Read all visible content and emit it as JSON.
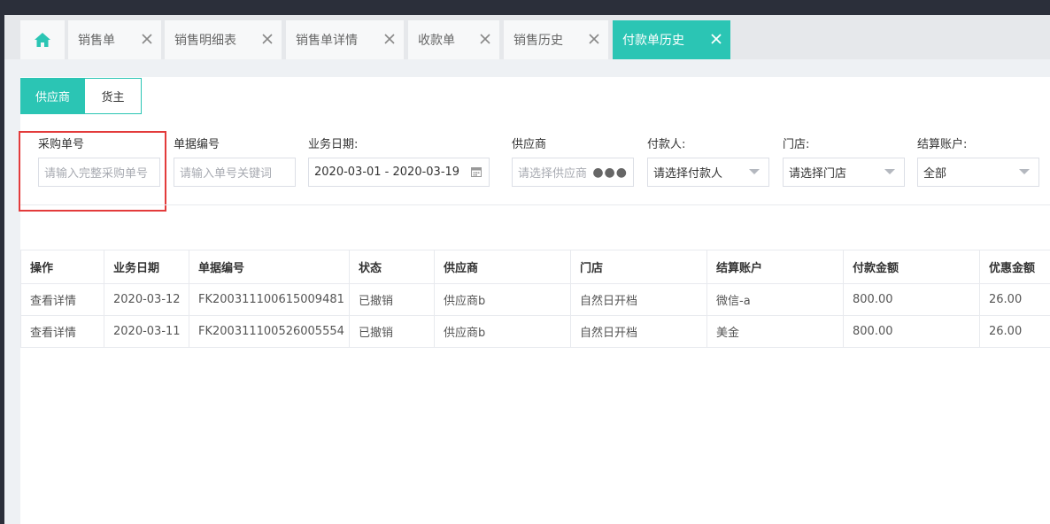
{
  "tabs": [
    {
      "label": "",
      "icon": "home-icon"
    },
    {
      "label": "销售单"
    },
    {
      "label": "销售明细表"
    },
    {
      "label": "销售单详情"
    },
    {
      "label": "收款单"
    },
    {
      "label": "销售历史"
    },
    {
      "label": "付款单历史",
      "active": true
    }
  ],
  "segments": {
    "supplier": "供应商",
    "owner": "货主"
  },
  "filters": {
    "purchase_no": {
      "label": "采购单号",
      "placeholder": "请输入完整采购单号"
    },
    "doc_no": {
      "label": "单据编号",
      "placeholder": "请输入单号关键词"
    },
    "biz_date": {
      "label": "业务日期:",
      "value": "2020-03-01 - 2020-03-19"
    },
    "supplier": {
      "label": "供应商",
      "placeholder": "请选择供应商"
    },
    "payer": {
      "label": "付款人:",
      "value": "请选择付款人"
    },
    "store": {
      "label": "门店:",
      "value": "请选择门店"
    },
    "account": {
      "label": "结算账户:",
      "value": "全部"
    }
  },
  "table": {
    "headers": [
      "操作",
      "业务日期",
      "单据编号",
      "状态",
      "供应商",
      "门店",
      "结算账户",
      "付款金额",
      "优惠金额"
    ],
    "rows": [
      [
        "查看详情",
        "2020-03-12",
        "FK200311100615009481",
        "已撤销",
        "供应商b",
        "自然日开档",
        "微信-a",
        "800.00",
        "26.00"
      ],
      [
        "查看详情",
        "2020-03-11",
        "FK200311100526005554",
        "已撤销",
        "供应商b",
        "自然日开档",
        "美金",
        "800.00",
        "26.00"
      ]
    ]
  },
  "colors": {
    "accent": "#2bc5b4",
    "highlight": "#e33b3b"
  }
}
